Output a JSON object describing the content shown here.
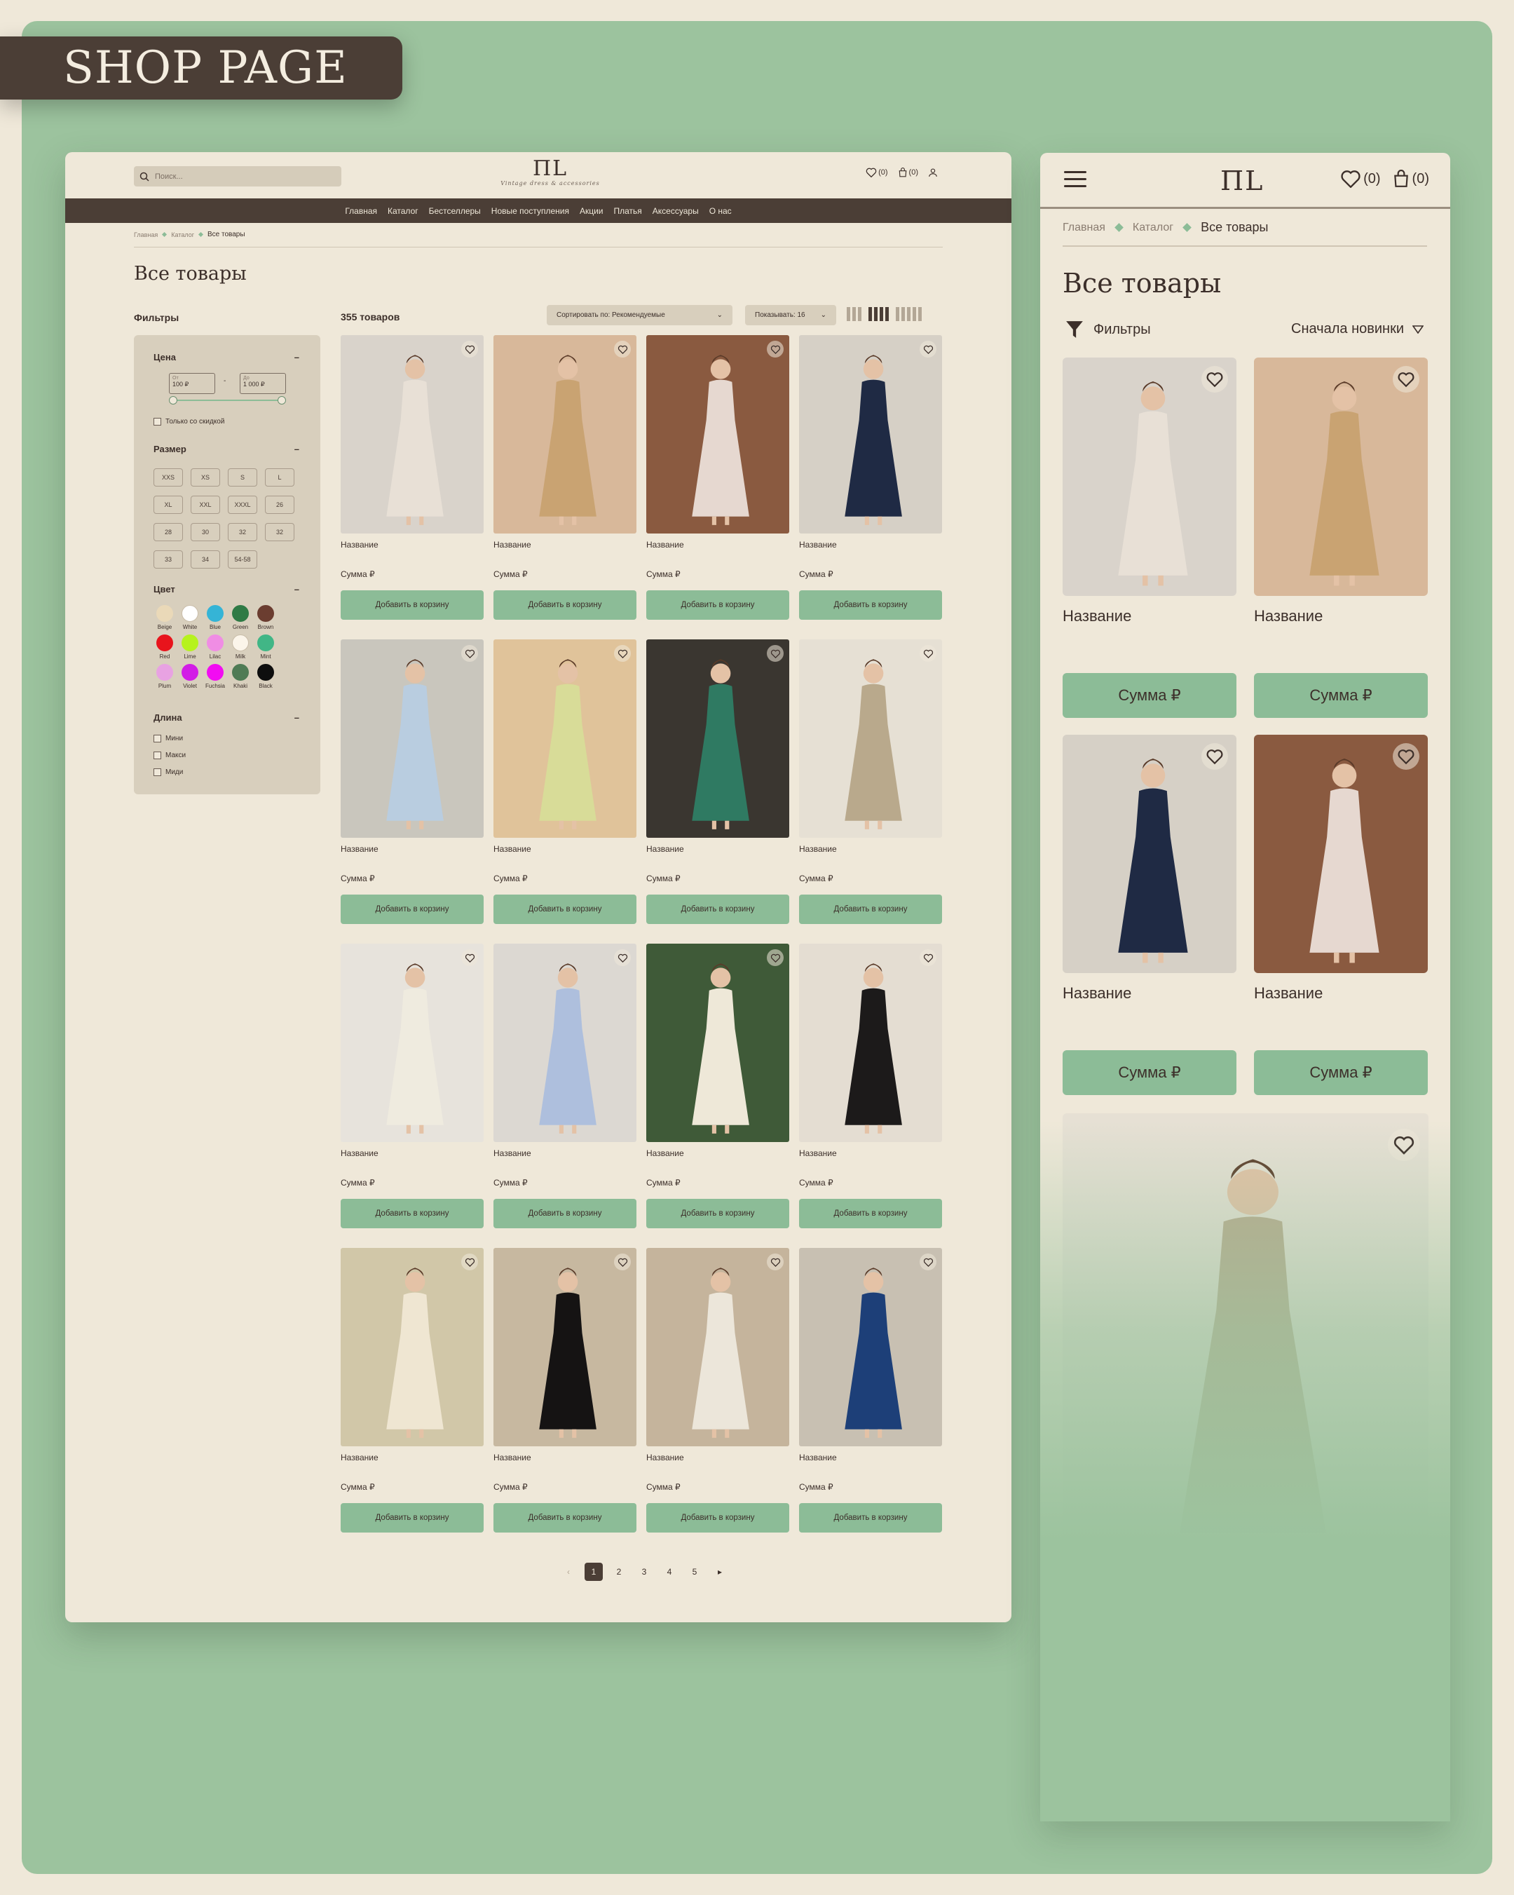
{
  "presentation_label": "SHOP PAGE",
  "desktop": {
    "search_placeholder": "Поиск...",
    "logo": "ΠL",
    "logo_tagline": "Vintage dress & accessories",
    "favorites_count": "(0)",
    "cart_count": "(0)",
    "nav": [
      "Главная",
      "Каталог",
      "Бестселлеры",
      "Новые поступления",
      "Акции",
      "Платья",
      "Аксессуары",
      "О нас"
    ],
    "breadcrumb": [
      "Главная",
      "Каталог",
      "Все товары"
    ],
    "page_title": "Все товары",
    "filters_title": "Фильтры",
    "filters": {
      "price_label": "Цена",
      "price_from_label": "От",
      "price_from": "100 ₽",
      "price_to_label": "До",
      "price_to": "1 000 ₽",
      "discount_only": "Только со скидкой",
      "size_label": "Размер",
      "sizes": [
        "XXS",
        "XS",
        "S",
        "L",
        "XL",
        "XXL",
        "XXXL",
        "26",
        "28",
        "30",
        "32",
        "32",
        "33",
        "34",
        "54-58"
      ],
      "color_label": "Цвет",
      "colors": [
        {
          "name": "Beige",
          "hex": "#ead9b8"
        },
        {
          "name": "White",
          "hex": "#ffffff"
        },
        {
          "name": "Blue",
          "hex": "#35b4d6"
        },
        {
          "name": "Green",
          "hex": "#2f7a45"
        },
        {
          "name": "Brown",
          "hex": "#6b3d30"
        },
        {
          "name": "Red",
          "hex": "#e8141c"
        },
        {
          "name": "Lime",
          "hex": "#b6f21e"
        },
        {
          "name": "Lilac",
          "hex": "#f08de4"
        },
        {
          "name": "Milk",
          "hex": "#fbf5ea"
        },
        {
          "name": "Mint",
          "hex": "#41b686"
        },
        {
          "name": "Plum",
          "hex": "#e8a2e2"
        },
        {
          "name": "Violet",
          "hex": "#d21de6"
        },
        {
          "name": "Fuchsia",
          "hex": "#f20cf2"
        },
        {
          "name": "Khaki",
          "hex": "#4f7b55"
        },
        {
          "name": "Black",
          "hex": "#0e0e0e"
        }
      ],
      "length_label": "Длина",
      "lengths": [
        "Мини",
        "Макси",
        "Миди"
      ]
    },
    "product_count": "355 товаров",
    "sort_label": "Сортировать по: Рекомендуемые",
    "show_label": "Показывать: 16",
    "product_name": "Название",
    "product_price": "Сумма ₽",
    "add_to_cart": "Добавить в корзину",
    "products": [
      {
        "img": "#d9d3cb",
        "dress": "#e8e0d6"
      },
      {
        "img": "#d8b89a",
        "dress": "#c9a372"
      },
      {
        "img": "#8a5a40",
        "dress": "#e6d8d0"
      },
      {
        "img": "#d6d0c6",
        "dress": "#1f2a44"
      },
      {
        "img": "#c9c6bd",
        "dress": "#b9cde0"
      },
      {
        "img": "#e0c39a",
        "dress": "#d8dc98"
      },
      {
        "img": "#3a3630",
        "dress": "#2f7a62"
      },
      {
        "img": "#e6e0d4",
        "dress": "#b9a98c"
      },
      {
        "img": "#e7e3dc",
        "dress": "#efebdf"
      },
      {
        "img": "#dcd8d2",
        "dress": "#aebfdd"
      },
      {
        "img": "#3f5a38",
        "dress": "#eee8d8"
      },
      {
        "img": "#e4ddd2",
        "dress": "#1c1a1a"
      },
      {
        "img": "#d1c7a8",
        "dress": "#efe6d2"
      },
      {
        "img": "#c7b8a0",
        "dress": "#151313"
      },
      {
        "img": "#c5b49c",
        "dress": "#ece6da"
      },
      {
        "img": "#c8c0b2",
        "dress": "#1d3f78"
      }
    ],
    "pagination": [
      "1",
      "2",
      "3",
      "4",
      "5"
    ]
  },
  "mobile": {
    "logo": "ΠL",
    "favorites_count": "(0)",
    "cart_count": "(0)",
    "breadcrumb": [
      "Главная",
      "Каталог",
      "Все товары"
    ],
    "page_title": "Все товары",
    "filters_label": "Фильтры",
    "sort_label": "Сначала новинки",
    "product_name": "Название",
    "product_price": "Сумма ₽",
    "products": [
      {
        "img": "#d9d3cb",
        "dress": "#e8e0d6"
      },
      {
        "img": "#d8b89a",
        "dress": "#c9a372"
      },
      {
        "img": "#d6d0c6",
        "dress": "#1f2a44"
      },
      {
        "img": "#8a5a40",
        "dress": "#e6d8d0"
      },
      {
        "img": "#e6e0d4",
        "dress": "#b9a98c"
      }
    ]
  },
  "colors": {
    "board": "#9cc39e",
    "page_bg": "#efe8d9",
    "accent": "#8cbc97",
    "dark": "#4b3e36"
  }
}
